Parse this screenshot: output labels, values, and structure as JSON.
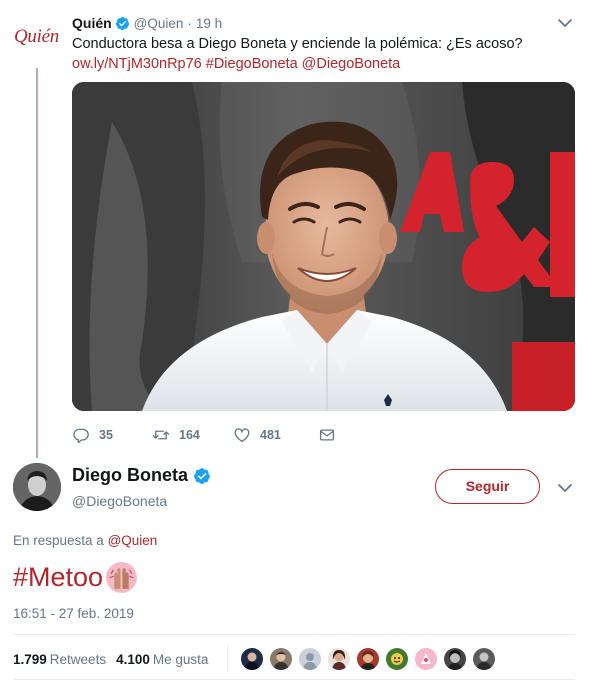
{
  "parent_tweet": {
    "avatar_text": "Quién",
    "display_name": "Quién",
    "handle": "@Quien",
    "separator": "·",
    "time": "19 h",
    "text": "Conductora besa a Diego Boneta y enciende la polémica: ¿Es acoso?",
    "link_url": "ow.ly/NTjM30nRp76",
    "link_hashtag": "#DiegoBoneta",
    "link_mention": "@DiegoBoneta",
    "actions": {
      "reply_count": "35",
      "retweet_count": "164",
      "like_count": "481"
    }
  },
  "main_tweet": {
    "display_name": "Diego Boneta",
    "handle": "@DiegoBoneta",
    "follow_label": "Seguir",
    "reply_context_prefix": "En respuesta a",
    "reply_context_mention": "@Quien",
    "text_hashtag": "#Metoo",
    "timestamp": "16:51 - 27 feb. 2019",
    "stats": {
      "retweets_count": "1.799",
      "retweets_label": "Retweets",
      "likes_count": "4.100",
      "likes_label": "Me gusta"
    },
    "liker_count": 9
  },
  "colors": {
    "accent": "#b3262c",
    "verified": "#1da1f2",
    "muted": "#657786",
    "text": "#14171a",
    "thread_line": "#c4a2a8"
  },
  "icons": {
    "reply": "reply-icon",
    "retweet": "retweet-icon",
    "like": "heart-icon",
    "message": "envelope-icon",
    "verified": "verified-badge-icon",
    "caret": "chevron-down-icon",
    "emoji": "raised-hands-emoji-icon"
  }
}
